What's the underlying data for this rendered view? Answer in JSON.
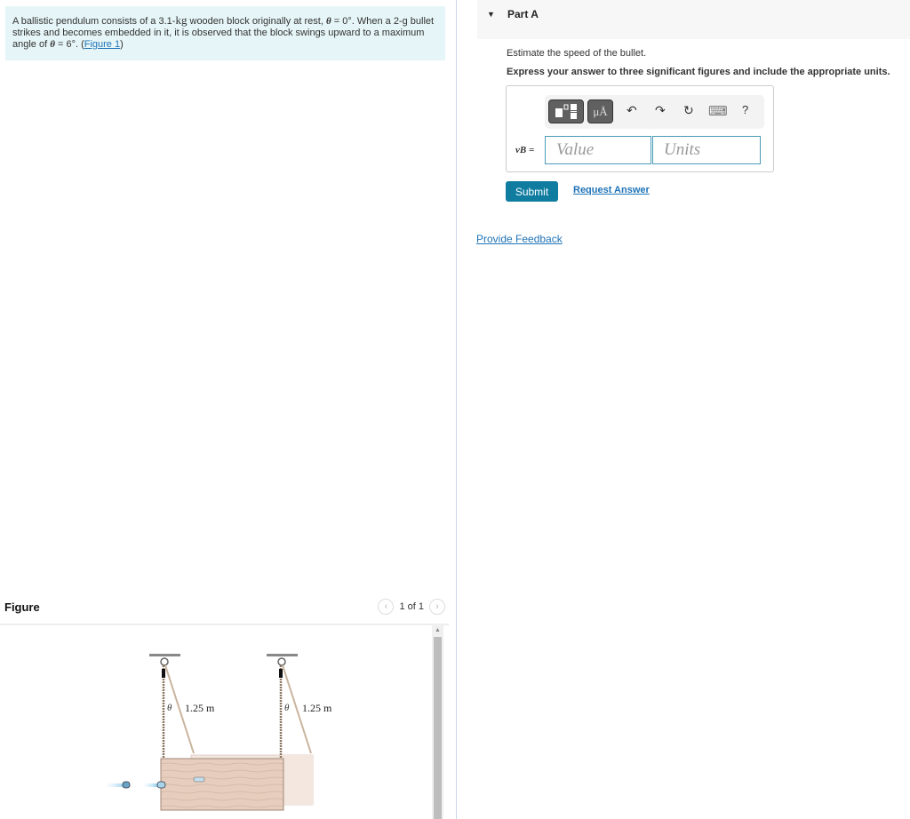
{
  "problem": {
    "text_1": "A ballistic pendulum consists of a 3.1-",
    "unit_kg": "kg",
    "text_2": " wooden block originally at rest, ",
    "theta": "θ",
    "text_3": " = 0°. When a 2-g bullet strikes and becomes embedded in it, it is observed that the block swings upward to a maximum angle of ",
    "text_4": " = 6°. (",
    "figure_link": "Figure 1",
    "text_5": ")"
  },
  "figure": {
    "title": "Figure",
    "pager": "1 of 1",
    "prev_icon": "‹",
    "next_icon": "›",
    "labels": {
      "length_left": "1.25 m",
      "length_right": "1.25 m",
      "theta": "θ"
    }
  },
  "part": {
    "caret": "▼",
    "title": "Part A",
    "question": "Estimate the speed of the bullet.",
    "instruction": "Express your answer to three significant figures and include the appropriate units."
  },
  "answer": {
    "variable_label": "vB =",
    "value_placeholder": "Value",
    "units_placeholder": "Units",
    "toolbar": {
      "units_button": "μÅ",
      "undo": "↶",
      "redo": "↷",
      "reset": "↻",
      "keyboard": "⌨",
      "help": "?"
    }
  },
  "buttons": {
    "submit": "Submit",
    "request_answer": "Request Answer",
    "provide_feedback": "Provide Feedback"
  }
}
